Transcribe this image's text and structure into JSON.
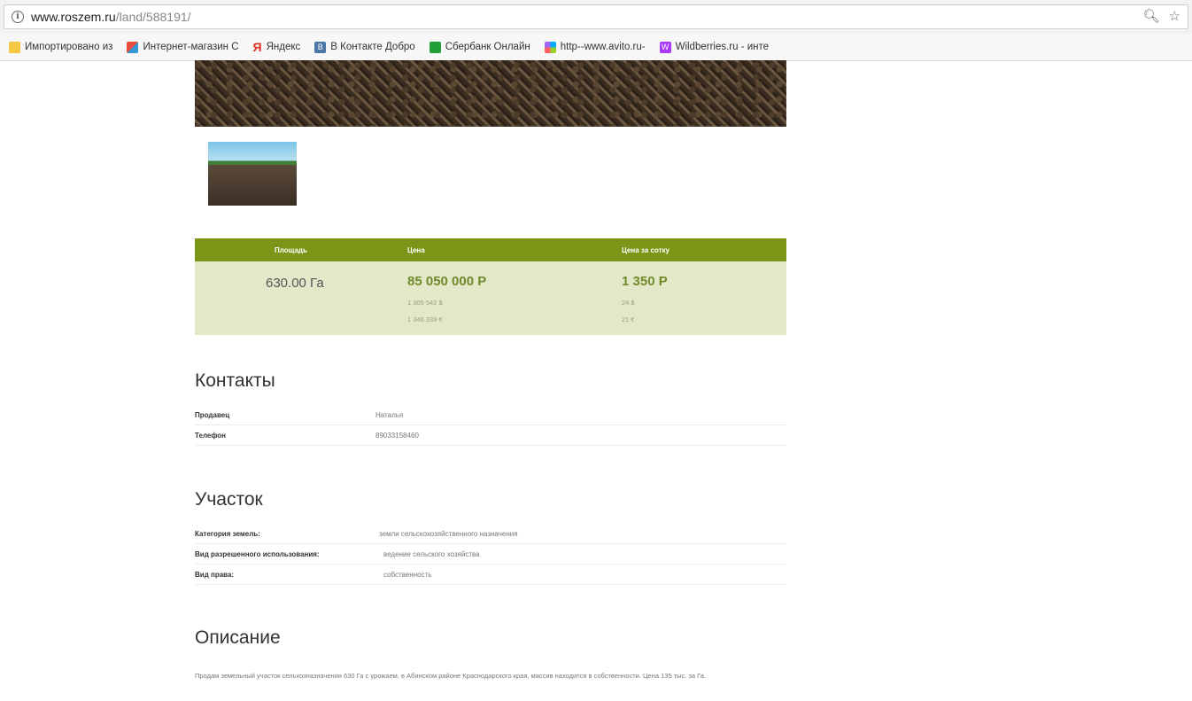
{
  "browser": {
    "url_host": "www.roszem.ru",
    "url_path": "/land/588191/",
    "zoom_icon": "zoom-icon",
    "star_icon": "star-icon"
  },
  "bookmarks": [
    {
      "label": "Импортировано из ",
      "icon": "folder-icon"
    },
    {
      "label": "Интернет-магазин С",
      "icon": "shop-icon"
    },
    {
      "label": "Яндекс",
      "icon": "yandex-icon"
    },
    {
      "label": "В Контакте  Добро",
      "icon": "vk-icon"
    },
    {
      "label": "Сбербанк Онлайн",
      "icon": "sberbank-icon"
    },
    {
      "label": "http--www.avito.ru-",
      "icon": "avito-icon"
    },
    {
      "label": "Wildberries.ru - инте",
      "icon": "wildberries-icon"
    }
  ],
  "price": {
    "col_area": "Площадь",
    "col_price": "Цена",
    "col_price_per": "Цена за сотку",
    "area": "630.00 Га",
    "price": "85 050 000 Р",
    "price_usd": "1 305 542 $",
    "price_eur": "1 346 339 €",
    "per": "1 350 Р",
    "per_usd": "24 $",
    "per_eur": "21 €"
  },
  "contacts": {
    "title": "Контакты",
    "seller_label": "Продавец",
    "seller_value": "Наталья",
    "phone_label": "Телефон",
    "phone_value": "89033158460"
  },
  "plot": {
    "title": "Участок",
    "category_label": "Категория земель:",
    "category_value": "земли сельскохозяйственного назначения",
    "use_label": "Вид разрешенного использования:",
    "use_value": "ведение сельского хозяйства",
    "right_label": "Вид права:",
    "right_value": "собственность"
  },
  "description": {
    "title": "Описание",
    "text": "Продам земельный участок сельхозназначения 630 Га с урожаем, в Абинском районе Краснодарского края, массив находится в собственности. Цена 135 тыс. за Га."
  }
}
